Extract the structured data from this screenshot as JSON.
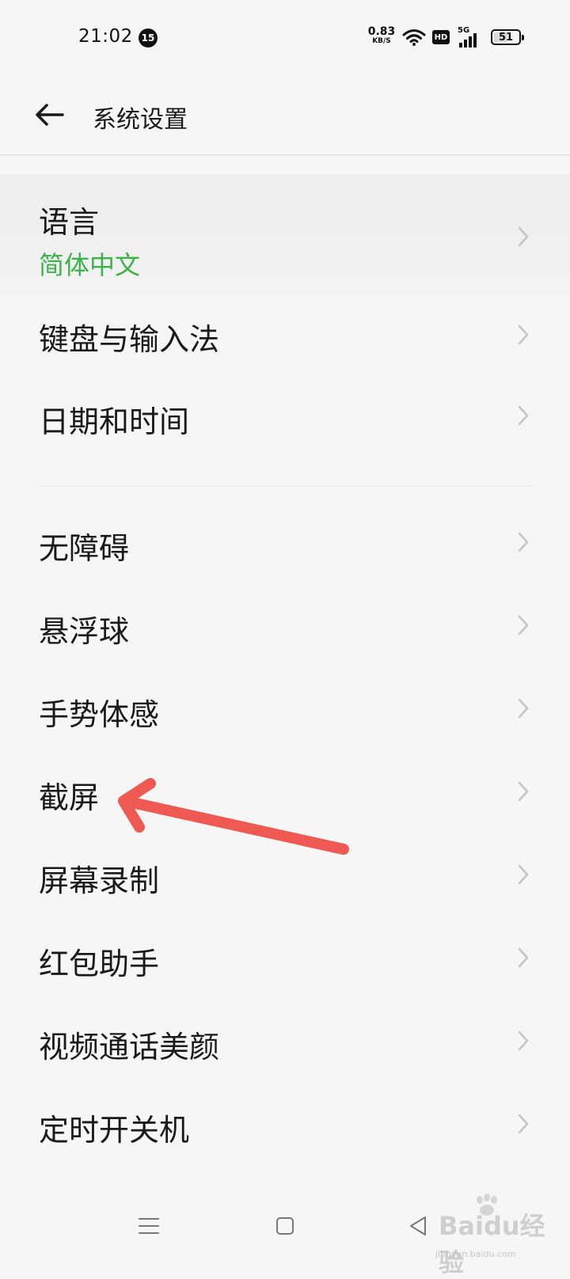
{
  "status_bar": {
    "time": "21:02",
    "notification_count": "15",
    "net_speed_value": "0.83",
    "net_speed_unit": "KB/S",
    "hd_label": "HD",
    "network_type": "5G",
    "battery_level": "51"
  },
  "header": {
    "title": "系统设置",
    "back_icon": "arrow-left-icon"
  },
  "items": [
    {
      "label": "语言",
      "sub": "简体中文"
    },
    {
      "label": "键盘与输入法"
    },
    {
      "label": "日期和时间"
    },
    {
      "label": "无障碍"
    },
    {
      "label": "悬浮球"
    },
    {
      "label": "手势体感"
    },
    {
      "label": "截屏"
    },
    {
      "label": "屏幕录制"
    },
    {
      "label": "红包助手"
    },
    {
      "label": "视频通话美颜"
    },
    {
      "label": "定时开关机"
    }
  ],
  "nav_bar": {
    "menu_icon": "menu-lines-icon",
    "home_icon": "home-square-icon",
    "back_icon": "back-triangle-icon"
  },
  "watermark": {
    "logo": "Baidu经验",
    "sub": "jingyan.baidu.com"
  },
  "colors": {
    "background": "#f6f6f6",
    "accent_green": "#3bb34a",
    "annotation_red": "#ee5a52"
  }
}
